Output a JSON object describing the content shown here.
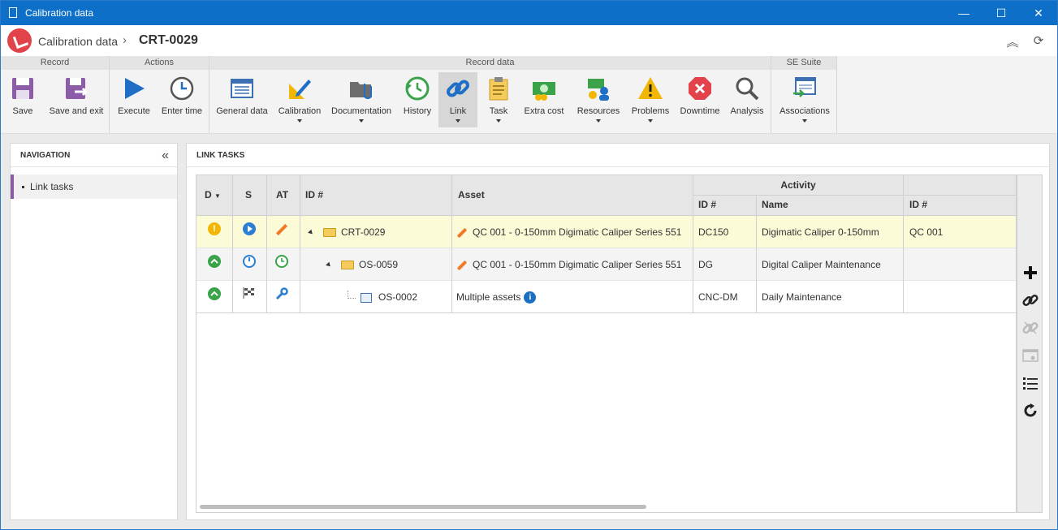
{
  "window": {
    "title": "Calibration data"
  },
  "header": {
    "breadcrumb_root": "Calibration data",
    "separator": "›",
    "record_id": "CRT-0029"
  },
  "ribbon": {
    "groups": [
      {
        "title": "Record",
        "buttons": [
          {
            "label": "Save",
            "icon": "save-icon"
          },
          {
            "label": "Save and exit",
            "icon": "save-exit-icon"
          }
        ]
      },
      {
        "title": "Actions",
        "buttons": [
          {
            "label": "Execute",
            "icon": "play-icon"
          },
          {
            "label": "Enter time",
            "icon": "clock-icon"
          }
        ]
      },
      {
        "title": "Record data",
        "buttons": [
          {
            "label": "General data",
            "icon": "form-icon"
          },
          {
            "label": "Calibration",
            "icon": "ruler-pencil-icon"
          },
          {
            "label": "Documentation",
            "icon": "folder-clip-icon"
          },
          {
            "label": "History",
            "icon": "history-icon"
          },
          {
            "label": "Link",
            "icon": "link-icon"
          },
          {
            "label": "Task",
            "icon": "clipboard-icon"
          },
          {
            "label": "Extra cost",
            "icon": "money-icon"
          },
          {
            "label": "Resources",
            "icon": "resources-icon"
          },
          {
            "label": "Problems",
            "icon": "warning-icon"
          },
          {
            "label": "Downtime",
            "icon": "stop-icon"
          },
          {
            "label": "Analysis",
            "icon": "magnifier-icon"
          }
        ]
      },
      {
        "title": "SE Suite",
        "buttons": [
          {
            "label": "Associations",
            "icon": "associations-icon"
          }
        ]
      }
    ]
  },
  "navigation": {
    "title": "NAVIGATION",
    "items": [
      {
        "label": "Link tasks"
      }
    ]
  },
  "main": {
    "title": "LINK TASKS",
    "columns": {
      "d": "D",
      "s": "S",
      "at": "AT",
      "id": "ID #",
      "asset": "Asset",
      "activity": "Activity",
      "activity_id": "ID #",
      "activity_name": "Name",
      "id2": "ID #"
    },
    "rows": [
      {
        "id": "CRT-0029",
        "asset": "QC 001 - 0-150mm Digimatic Caliper Series 551",
        "activity_id": "DC150",
        "activity_name": "Digimatic Caliper 0-150mm",
        "id2": "QC 001",
        "d_color": "#f2b705",
        "s_color": "#2a7fd4",
        "at_color": "#f07a26"
      },
      {
        "id": "OS-0059",
        "asset": "QC 001 - 0-150mm Digimatic Caliper Series 551",
        "activity_id": "DG",
        "activity_name": "Digital Caliper Maintenance",
        "id2": "",
        "d_color": "#3aa34a",
        "s_color": "#2a7fd4",
        "at_color": "#3aa34a"
      },
      {
        "id": "OS-0002",
        "asset": "Multiple assets",
        "activity_id": "CNC-DM",
        "activity_name": "Daily Maintenance",
        "id2": "",
        "d_color": "#3aa34a",
        "s_color": "#555555",
        "at_color": "#2a7fd4"
      }
    ]
  },
  "side_tools": [
    "add-icon",
    "link-icon",
    "unlink-icon",
    "view-icon",
    "list-icon",
    "refresh-icon"
  ]
}
